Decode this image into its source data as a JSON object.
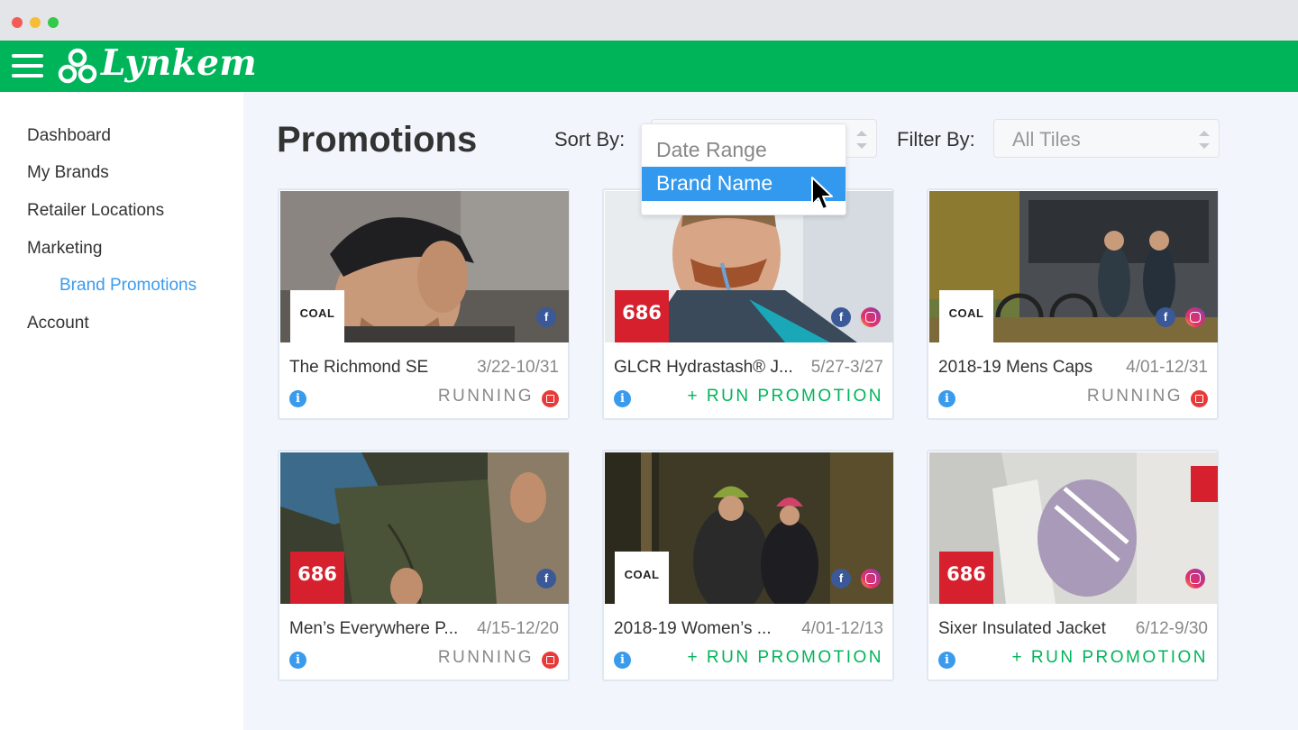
{
  "app": {
    "name": "Lynkem",
    "brand_color": "#00b45a",
    "accent_color": "#3a9bec"
  },
  "sidebar": {
    "items": [
      {
        "label": "Dashboard"
      },
      {
        "label": "My Brands"
      },
      {
        "label": "Retailer Locations"
      },
      {
        "label": "Marketing"
      },
      {
        "label": "Brand Promotions",
        "active": true
      },
      {
        "label": "Account"
      }
    ]
  },
  "main": {
    "title": "Promotions",
    "sort_label": "Sort By:",
    "filter_label": "Filter By:",
    "filter_value": "All Tiles",
    "sort_dropdown": {
      "options": [
        "Date Range",
        "Brand Name"
      ],
      "highlighted": "Brand Name"
    }
  },
  "tiles": [
    {
      "title": "The Richmond SE",
      "dates": "3/22-10/31",
      "brand": "COAL",
      "brand_logo": "coal-logo",
      "socials": [
        "facebook"
      ],
      "status": "RUNNING",
      "status_icon": "stop-icon"
    },
    {
      "title": "GLCR Hydrastash® J...",
      "dates": "5/27-3/27",
      "brand": "686",
      "brand_logo": "686-logo",
      "socials": [
        "facebook",
        "instagram"
      ],
      "status": "+ RUN PROMOTION"
    },
    {
      "title": "2018-19 Mens Caps",
      "dates": "4/01-12/31",
      "brand": "COAL",
      "brand_logo": "coal-logo",
      "socials": [
        "facebook",
        "instagram"
      ],
      "status": "RUNNING",
      "status_icon": "stop-icon"
    },
    {
      "title": "Men’s Everywhere P...",
      "dates": "4/15-12/20",
      "brand": "686",
      "brand_logo": "686-logo",
      "socials": [
        "facebook"
      ],
      "status": "RUNNING",
      "status_icon": "stop-icon"
    },
    {
      "title": "2018-19 Women’s ...",
      "dates": "4/01-12/13",
      "brand": "COAL",
      "brand_logo": "coal-logo",
      "socials": [
        "facebook",
        "instagram"
      ],
      "status": "+ RUN PROMOTION"
    },
    {
      "title": "Sixer Insulated Jacket",
      "dates": "6/12-9/30",
      "brand": "686",
      "brand_logo": "686-logo",
      "socials": [
        "instagram"
      ],
      "status": "+ RUN PROMOTION"
    }
  ]
}
